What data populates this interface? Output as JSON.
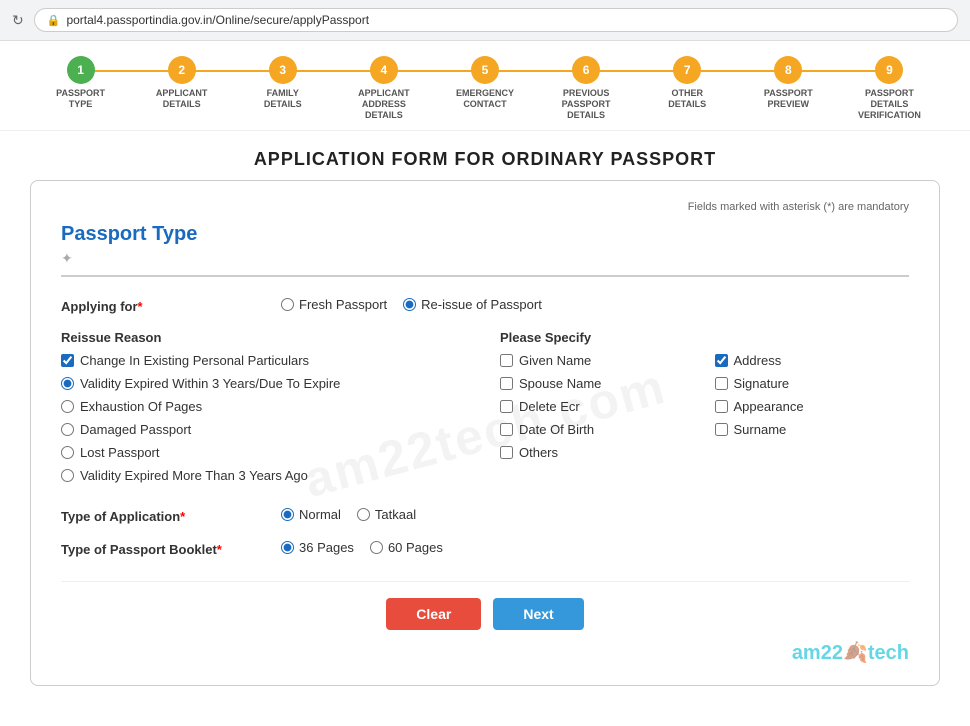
{
  "browser": {
    "url": "portal4.passportindia.gov.in/Online/secure/applyPassport",
    "refresh_title": "Refresh"
  },
  "progress": {
    "steps": [
      {
        "number": "1",
        "label": "PASSPORT TYPE",
        "active": true
      },
      {
        "number": "2",
        "label": "APPLICANT DETAILS",
        "active": false
      },
      {
        "number": "3",
        "label": "FAMILY DETAILS",
        "active": false
      },
      {
        "number": "4",
        "label": "APPLICANT ADDRESS DETAILS",
        "active": false
      },
      {
        "number": "5",
        "label": "EMERGENCY CONTACT",
        "active": false
      },
      {
        "number": "6",
        "label": "PREVIOUS PASSPORT DETAILS",
        "active": false
      },
      {
        "number": "7",
        "label": "OTHER DETAILS",
        "active": false
      },
      {
        "number": "8",
        "label": "PASSPORT PREVIEW",
        "active": false
      },
      {
        "number": "9",
        "label": "PASSPORT DETAILS VERIFICATION",
        "active": false
      }
    ]
  },
  "page": {
    "title": "APPLICATION FORM FOR ORDINARY PASSPORT"
  },
  "form": {
    "mandatory_note": "Fields marked with asterisk (*) are mandatory",
    "section_title": "Passport Type",
    "applying_for_label": "Applying for",
    "applying_for_required": true,
    "fresh_passport_option": "Fresh Passport",
    "reissue_option": "Re-issue of Passport",
    "reissue_selected": true,
    "reissue_reason_label": "Reissue Reason",
    "reissue_options": [
      {
        "id": "r1",
        "label": "Change In Existing Personal Particulars",
        "checked": true,
        "type": "checkbox"
      },
      {
        "id": "r2",
        "label": "Validity Expired Within 3 Years/Due To Expire",
        "checked": true,
        "type": "radio"
      },
      {
        "id": "r3",
        "label": "Exhaustion Of Pages",
        "checked": false,
        "type": "radio"
      },
      {
        "id": "r4",
        "label": "Damaged Passport",
        "checked": false,
        "type": "radio"
      },
      {
        "id": "r5",
        "label": "Lost Passport",
        "checked": false,
        "type": "radio"
      },
      {
        "id": "r6",
        "label": "Validity Expired More Than 3 Years Ago",
        "checked": false,
        "type": "radio"
      }
    ],
    "please_specify_label": "Please Specify",
    "specify_col1": [
      {
        "id": "s1",
        "label": "Given Name",
        "checked": false
      },
      {
        "id": "s2",
        "label": "Spouse Name",
        "checked": false
      },
      {
        "id": "s3",
        "label": "Delete Ecr",
        "checked": false
      },
      {
        "id": "s4",
        "label": "Date Of Birth",
        "checked": false
      },
      {
        "id": "s5",
        "label": "Others",
        "checked": false
      }
    ],
    "specify_col2": [
      {
        "id": "s6",
        "label": "Address",
        "checked": true
      },
      {
        "id": "s7",
        "label": "Signature",
        "checked": false
      },
      {
        "id": "s8",
        "label": "Appearance",
        "checked": false
      },
      {
        "id": "s9",
        "label": "Surname",
        "checked": false
      }
    ],
    "type_of_application_label": "Type of Application",
    "type_of_application_required": true,
    "application_options": [
      {
        "id": "a1",
        "label": "Normal",
        "selected": true
      },
      {
        "id": "a2",
        "label": "Tatkaal",
        "selected": false
      }
    ],
    "type_of_booklet_label": "Type of Passport Booklet",
    "type_of_booklet_required": true,
    "booklet_options": [
      {
        "id": "b1",
        "label": "36 Pages",
        "selected": true
      },
      {
        "id": "b2",
        "label": "60 Pages",
        "selected": false
      }
    ],
    "clear_button": "Clear",
    "next_button": "Next",
    "watermark_text": "am22tech.com",
    "brand_text_pre": "am22",
    "brand_text_post": "tech"
  }
}
